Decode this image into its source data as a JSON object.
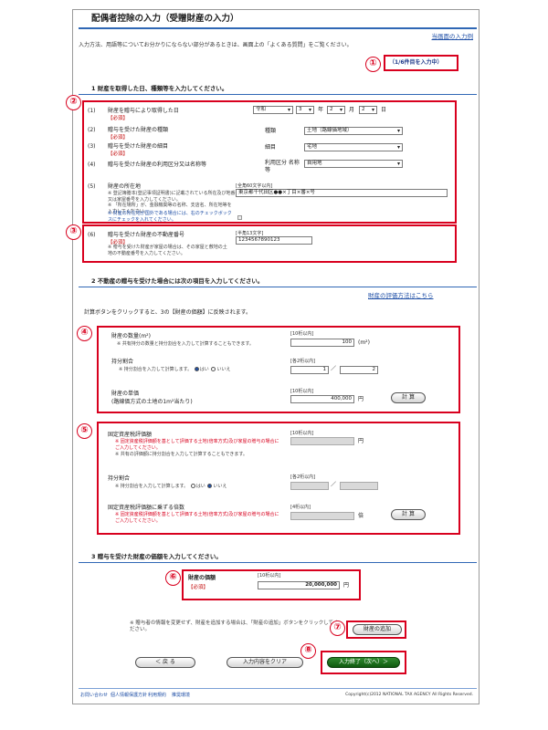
{
  "header": {
    "title": "配偶者控除の入力（受贈財産の入力）",
    "current_link": "当画面の入力例",
    "intro": "入力方法、用語等についてお分かりにならない部分があるときは、画面上の「よくある質問」をご覧ください。",
    "count": "（1/6件目を入力中）"
  },
  "callouts": [
    "①",
    "②",
    "③",
    "④",
    "⑤",
    "⑥",
    "⑦",
    "⑧"
  ],
  "section1": {
    "heading": "1 財産を取得した日、種類等を入力してください。",
    "rows": [
      {
        "no": "(1)",
        "label": "財産を贈与により取得した日",
        "req": "【必須】"
      },
      {
        "no": "(2)",
        "label": "贈与を受けた財産の種類",
        "req": "【必須】"
      },
      {
        "no": "(3)",
        "label": "贈与を受けた財産の細目",
        "req": "【必須】"
      },
      {
        "no": "(4)",
        "label": "贈与を受けた財産の利用区分又は名称等",
        "req": ""
      },
      {
        "no": "(5)",
        "label": "財産の所在地",
        "req": ""
      },
      {
        "no": "(6)",
        "label": "贈与を受けた財産の不動産番号",
        "req": "【必須】"
      }
    ],
    "date": {
      "era": "令和",
      "year": "3",
      "year_unit": "年",
      "month": "2",
      "month_unit": "月",
      "day": "2",
      "day_unit": "日"
    },
    "kind_label": "種類",
    "kind_value": "土地（路線価地域）",
    "detail_label": "細目",
    "detail_value": "宅地",
    "usage_label": "利用区分 名称等",
    "usage_value": "自用地",
    "location_hint": "[全角60文字以内]",
    "location_value": "東京都千代田区●●×丁目×番×号",
    "location_notes": [
      "※ 登記簿謄本(登記事項証明書)に記載されている所在及び地番又は家屋番号を入力してください。",
      "※ 「所在場所」が、金融機関等の名称、支店名、所在地等を入力してください。",
      "※ 財産の所在地が国外である場合には、右のチェックボックスにチェックを入れてください。"
    ],
    "realty_hint": "[半角13文字]",
    "realty_value": "1234567890123",
    "realty_notes": "※ 贈与を受けた財産が家屋の場合は、その家屋と敷地の土地の不動産番号を入力してください。"
  },
  "section2": {
    "heading": "2 不動産の贈与を受けた場合には次の項目を入力してください。",
    "eval_link": "財産の評価方法はこちら",
    "calc_note": "計算ボタンをクリックすると、3の【財産の価額】に反映されます。",
    "qty_label": "財産の数量(m²)",
    "qty_note": "※ 共有持分の数量と持分割合を入力して計算することもできます。",
    "qty_hint": "[10桁以内]",
    "qty_value": "100",
    "qty_unit": "(m²)",
    "share_label": "持分割合",
    "share_note": "※ 持分割合を入力して計算します。",
    "share_yes": "はい",
    "share_no": "いいえ",
    "share_hint": "[各2桁以内]",
    "share_num": "1",
    "share_den": "2",
    "share_sep": "／",
    "unit_label": "財産の単価",
    "unit_label2": "(路線価方式の土地の1m²当たり)",
    "unit_hint": "[10桁以内]",
    "unit_value": "400,000",
    "unit_suffix": "円",
    "calc_button": "計 算",
    "fixed_label": "固定資産税評価額",
    "fixed_rednote": "※ 固定資産税評価額を基として評価する土地(倍率方式)及び家屋の贈与の場合にご入力してください。",
    "fixed_note": "※ 共有の評価額に持分割合を入力して計算することもできます。",
    "fixed_hint": "[10桁以内]",
    "fixed_suffix": "円",
    "share2_label": "持分割合",
    "share2_note": "※ 持分割合を入力して計算します。",
    "share2_yes": "はい",
    "share2_no": "いいえ",
    "share2_hint": "[各2桁以内]",
    "share2_sep": "／",
    "mult_label": "固定資産税評価額に乗ずる倍数",
    "mult_rednote": "※ 固定資産税評価額を基として評価する土地(倍率方式)及び家屋の贈与の場合にご入力してください。",
    "mult_hint": "[4桁以内]",
    "mult_suffix": "倍",
    "calc_button2": "計 算"
  },
  "section3": {
    "heading": "3 贈与を受けた財産の価額を入力してください。",
    "value_label": "財産の価額",
    "value_req": "【必須】",
    "value_hint": "[10桁以内]",
    "value": "20,000,000",
    "value_suffix": "円"
  },
  "bottom": {
    "add_note": "※ 贈与者の情報を変更せず、財産を追加する場合は、「財産の追加」ボタンをクリックしてください。",
    "add_button": "財産の追加",
    "back_button": "＜ 戻 る",
    "clear_button": "入力内容をクリア",
    "finish_button": "入力終了（次へ）＞"
  },
  "footer": {
    "links": [
      "お問い合わせ",
      "個人情報保護方針",
      "利用規約",
      "推奨環境"
    ],
    "copyright": "Copyright(c)2012 NATIONAL TAX AGENCY All Rights Reserved."
  },
  "colors": {
    "accent": "#2f67b5",
    "callout": "#d8001e",
    "link": "#1f4fa6",
    "green": "#0f5a0f"
  }
}
